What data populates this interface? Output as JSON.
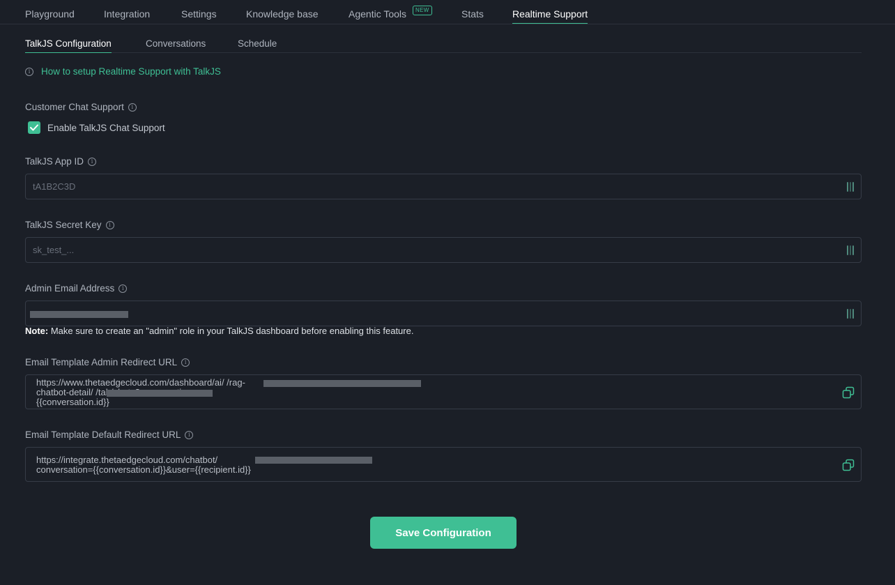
{
  "top_tabs": [
    {
      "label": "Playground"
    },
    {
      "label": "Integration"
    },
    {
      "label": "Settings"
    },
    {
      "label": "Knowledge base"
    },
    {
      "label": "Agentic Tools",
      "badge": "NEW"
    },
    {
      "label": "Stats"
    },
    {
      "label": "Realtime Support",
      "active": true
    }
  ],
  "sub_tabs": [
    {
      "label": "TalkJS Configuration",
      "active": true
    },
    {
      "label": "Conversations"
    },
    {
      "label": "Schedule"
    }
  ],
  "help_link": {
    "text": "How to setup Realtime Support with TalkJS",
    "icon": "info-icon"
  },
  "customer_chat": {
    "label": "Customer Chat Support",
    "checkbox_label": "Enable TalkJS Chat Support",
    "checked": true
  },
  "app_id": {
    "label": "TalkJS App ID",
    "placeholder": "tA1B2C3D",
    "value": ""
  },
  "secret_key": {
    "label": "TalkJS Secret Key",
    "placeholder": "sk_test_...",
    "value": ""
  },
  "admin_email": {
    "label": "Admin Email Address",
    "value": ""
  },
  "note": {
    "prefix": "Note:",
    "text": " Make sure to create an \"admin\" role in your TalkJS dashboard before enabling this feature."
  },
  "admin_redirect": {
    "label": "Email Template Admin Redirect URL",
    "value": "https://www.thetaedgecloud.com/dashboard/ai/                                                          /rag-\nchatbot-detail/                                     /tab/chats?conversation=\n{{conversation.id}}"
  },
  "default_redirect": {
    "label": "Email Template Default Redirect URL",
    "value": "https://integrate.thetaedgecloud.com/chatbot/\nconversation={{conversation.id}}&user={{recipient.id}}"
  },
  "save_button": {
    "label": "Save Configuration"
  },
  "colors": {
    "accent": "#3fbf94",
    "background": "#1b1f27",
    "border": "#363c47"
  }
}
